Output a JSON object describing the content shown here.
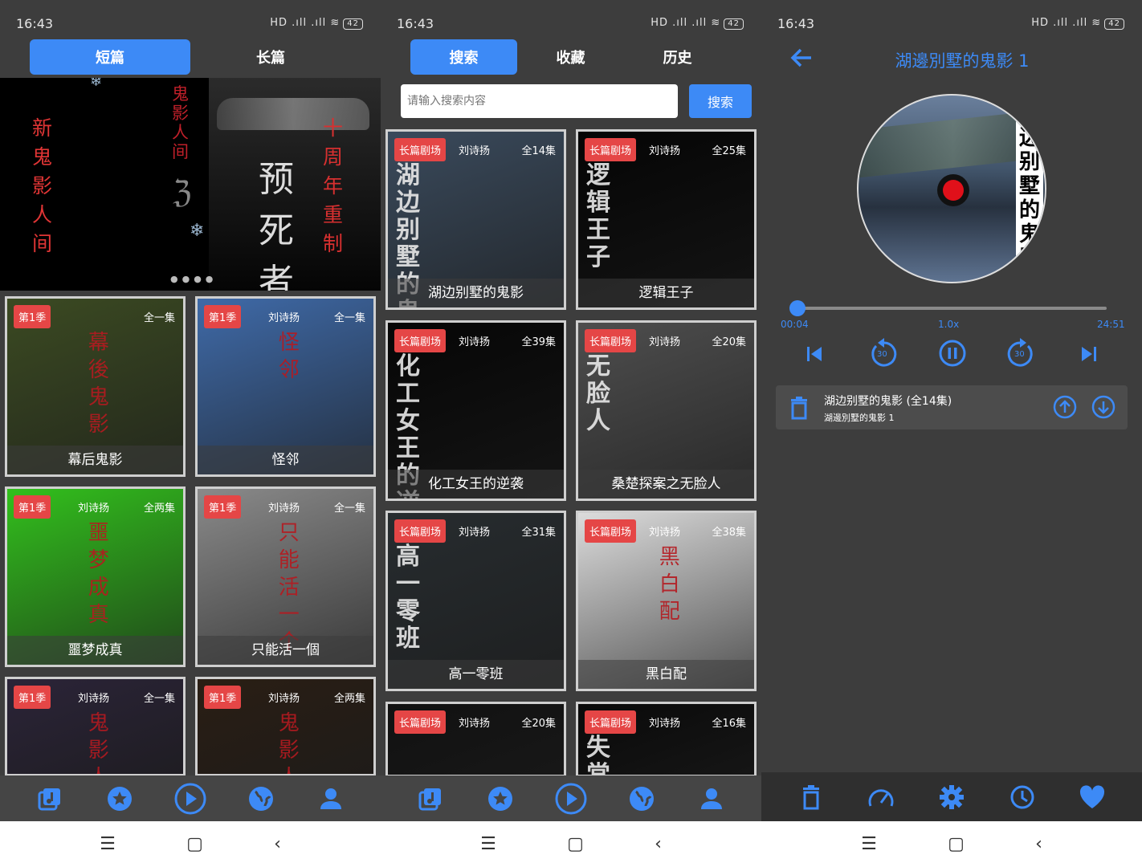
{
  "status": {
    "time": "16:43",
    "signal": "HD .ıll .ıll ≋",
    "battery": "42"
  },
  "panel1": {
    "tabs": [
      "短篇",
      "长篇"
    ],
    "banner": {
      "left_title": "新鬼影人间",
      "left_side": "鬼影人间",
      "right_title": "十周年重制",
      "right_sub": "预死者"
    },
    "cards": [
      {
        "season": "第1季",
        "author": "",
        "eps": "全一集",
        "title": "幕后鬼影",
        "art": "幕後鬼影",
        "color": "#3b4a22"
      },
      {
        "season": "第1季",
        "author": "刘诗扬",
        "eps": "全一集",
        "title": "怪邻",
        "art": "怪邻",
        "color": "#3f6aa8"
      },
      {
        "season": "第1季",
        "author": "刘诗扬",
        "eps": "全两集",
        "title": "噩梦成真",
        "art": "噩梦成真",
        "color": "#32c01c"
      },
      {
        "season": "第1季",
        "author": "刘诗扬",
        "eps": "全一集",
        "title": "只能活一個",
        "art": "只能活一个",
        "color": "#8a8a8a"
      },
      {
        "season": "第1季",
        "author": "刘诗扬",
        "eps": "全一集",
        "title": "",
        "art": "鬼影人间",
        "color": "#2b2438"
      },
      {
        "season": "第1季",
        "author": "刘诗扬",
        "eps": "全两集",
        "title": "",
        "art": "鬼影人间",
        "color": "#2a1e14"
      }
    ]
  },
  "panel2": {
    "tabs": [
      "搜索",
      "收藏",
      "历史"
    ],
    "search": {
      "placeholder": "请输入搜索内容",
      "button": "搜索"
    },
    "cards": [
      {
        "tag": "长篇剧场",
        "author": "刘诗扬",
        "eps": "全14集",
        "title": "湖边别墅的鬼影",
        "art": "湖边别墅的鬼影",
        "color": "#3a4a5c"
      },
      {
        "tag": "长篇剧场",
        "author": "刘诗扬",
        "eps": "全25集",
        "title": "逻辑王子",
        "art": "逻辑王子",
        "color": "#050505"
      },
      {
        "tag": "长篇剧场",
        "author": "刘诗扬",
        "eps": "全39集",
        "title": "化工女王的逆袭",
        "art": "化工女王的逆袭",
        "color": "#060606"
      },
      {
        "tag": "长篇剧场",
        "author": "刘诗扬",
        "eps": "全20集",
        "title": "桑楚探案之无脸人",
        "art": "无脸人",
        "color": "#4e4e4e"
      },
      {
        "tag": "长篇剧场",
        "author": "刘诗扬",
        "eps": "全31集",
        "title": "高一零班",
        "art": "高一零班",
        "color": "#272c2f"
      },
      {
        "tag": "长篇剧场",
        "author": "刘诗扬",
        "eps": "全38集",
        "title": "黑白配",
        "art": "黑白配",
        "color": "#dcdcdc"
      },
      {
        "tag": "长篇剧场",
        "author": "刘诗扬",
        "eps": "全20集",
        "title": "",
        "art": "",
        "color": "#111111"
      },
      {
        "tag": "长篇剧场",
        "author": "刘诗扬",
        "eps": "全16集",
        "title": "",
        "art": "失常",
        "color": "#0a0a0a"
      }
    ]
  },
  "panel3": {
    "title": "湖邊別墅的鬼影 1",
    "disc_text": "湖边别墅的鬼影",
    "time_current": "00:04",
    "speed": "1.0x",
    "time_total": "24:51",
    "progress": 0.003,
    "skip_back": "30",
    "skip_fwd": "30",
    "queue": {
      "title": "湖边别墅的鬼影 (全14集)",
      "sub": "湖邊別墅的鬼影 1"
    }
  },
  "sysnav": {
    "menu": "☰",
    "home": "▢",
    "back": "‹"
  },
  "colors": {
    "accent": "#3d8af6",
    "tag": "#e54646",
    "bg": "#3d3d3d"
  }
}
